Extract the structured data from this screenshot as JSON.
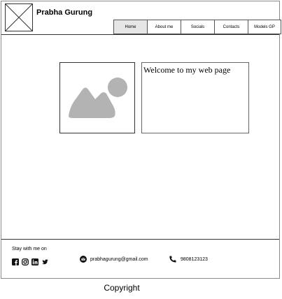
{
  "header": {
    "title": "Prabha Gurung",
    "nav": [
      {
        "label": "Home",
        "active": true
      },
      {
        "label": "About me",
        "active": false
      },
      {
        "label": "Socials",
        "active": false
      },
      {
        "label": "Contacts",
        "active": false
      },
      {
        "label": "Models GP",
        "active": false
      }
    ]
  },
  "main": {
    "welcome_text": "Welcome to my web page"
  },
  "footer": {
    "stay_label": "Stay with me on",
    "social_icons": [
      "facebook-icon",
      "instagram-icon",
      "linkedin-icon",
      "twitter-icon"
    ],
    "email": "prabhagurung@gmail.com",
    "phone": "9808123123"
  },
  "copyright": "Copyright",
  "colors": {
    "border": "#333333",
    "placeholder_gray": "#b3b3b3",
    "active_tab": "#e6e6e6"
  }
}
